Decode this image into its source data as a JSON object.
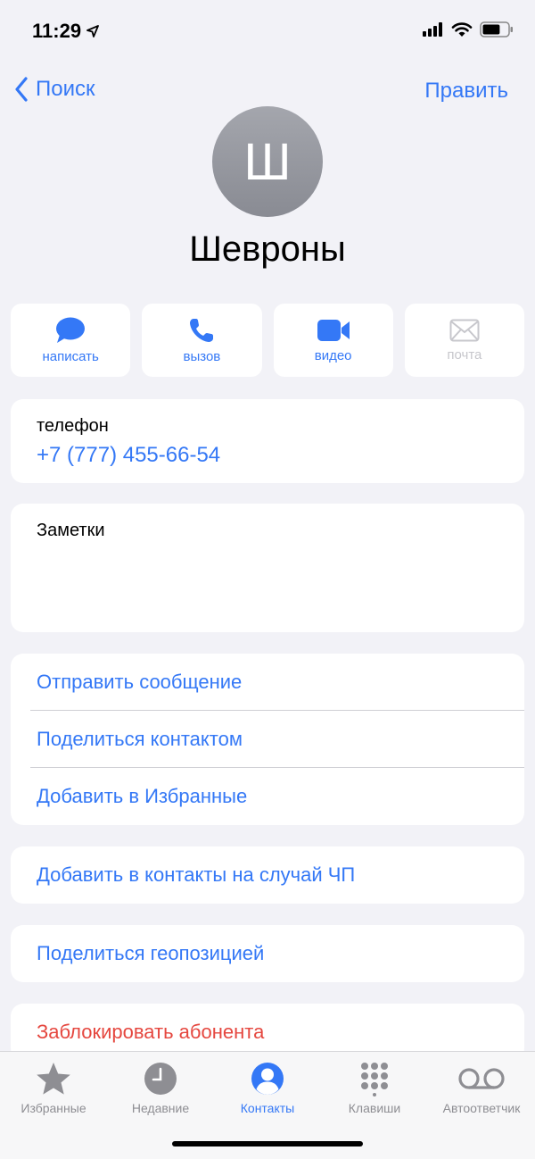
{
  "status": {
    "time": "11:29",
    "battery_fraction": 0.7
  },
  "nav": {
    "back_label": "Поиск",
    "edit_label": "Править"
  },
  "contact": {
    "initial": "Ш",
    "name": "Шевроны"
  },
  "actions": [
    {
      "label": "написать",
      "icon": "message-bubble-icon",
      "enabled": true
    },
    {
      "label": "вызов",
      "icon": "phone-icon",
      "enabled": true
    },
    {
      "label": "видео",
      "icon": "video-camera-icon",
      "enabled": true
    },
    {
      "label": "почта",
      "icon": "mail-envelope-icon",
      "enabled": false
    }
  ],
  "phone": {
    "label": "телефон",
    "number": "+7 (777) 455-66-54"
  },
  "notes": {
    "label": "Заметки"
  },
  "options": [
    "Отправить сообщение",
    "Поделиться контактом",
    "Добавить в Избранные"
  ],
  "emergency_label": "Добавить в контакты на случай ЧП",
  "location_label": "Поделиться геопозицией",
  "block_label": "Заблокировать абонента",
  "tabs": [
    {
      "label": "Избранные",
      "icon": "star-icon",
      "active": false
    },
    {
      "label": "Недавние",
      "icon": "clock-icon",
      "active": false
    },
    {
      "label": "Контакты",
      "icon": "person-circle-icon",
      "active": true
    },
    {
      "label": "Клавиши",
      "icon": "keypad-icon",
      "active": false
    },
    {
      "label": "Автоответчик",
      "icon": "voicemail-icon",
      "active": false
    }
  ],
  "colors": {
    "accent": "#3478f6",
    "destructive": "#e5473f",
    "background": "#f2f2f7",
    "avatar": "#999aa1",
    "inactive": "#8e8e93"
  }
}
